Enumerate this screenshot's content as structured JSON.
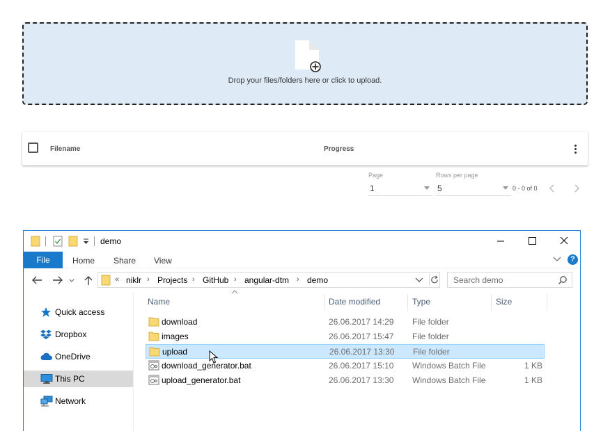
{
  "dropzone": {
    "text": "Drop your files/folders here or click to upload.",
    "icon": "file-add-icon"
  },
  "upload_table": {
    "columns": [
      "Filename",
      "Progress"
    ],
    "menu_icon": "more-vert-icon"
  },
  "paginator": {
    "page_label": "Page",
    "page_value": "1",
    "rows_label": "Rows per page",
    "rows_value": "5",
    "range": "0 - 0 of 0"
  },
  "explorer": {
    "title": "demo",
    "ribbon_tabs": [
      "File",
      "Home",
      "Share",
      "View"
    ],
    "address": {
      "prefix": "«",
      "crumbs": [
        "niklr",
        "Projects",
        "GitHub",
        "angular-dtm",
        "demo"
      ]
    },
    "search_placeholder": "Search demo",
    "nav_items": [
      {
        "label": "Quick access",
        "icon": "star-icon"
      },
      {
        "label": "Dropbox",
        "icon": "dropbox-icon"
      },
      {
        "label": "OneDrive",
        "icon": "cloud-icon"
      },
      {
        "label": "This PC",
        "icon": "computer-icon",
        "selected": true
      },
      {
        "label": "Network",
        "icon": "network-icon"
      }
    ],
    "columns": [
      "Name",
      "Date modified",
      "Type",
      "Size"
    ],
    "files": [
      {
        "name": "download",
        "date": "26.06.2017 14:29",
        "type": "File folder",
        "size": "",
        "icon": "folder-icon"
      },
      {
        "name": "images",
        "date": "26.06.2017 15:47",
        "type": "File folder",
        "size": "",
        "icon": "folder-icon"
      },
      {
        "name": "upload",
        "date": "26.06.2017 13:30",
        "type": "File folder",
        "size": "",
        "icon": "folder-icon",
        "selected": true
      },
      {
        "name": "download_generator.bat",
        "date": "26.06.2017 15:10",
        "type": "Windows Batch File",
        "size": "1 KB",
        "icon": "batch-file-icon"
      },
      {
        "name": "upload_generator.bat",
        "date": "26.06.2017 13:30",
        "type": "Windows Batch File",
        "size": "1 KB",
        "icon": "batch-file-icon"
      }
    ]
  },
  "colors": {
    "dropzone_bg": "#deeaf6",
    "accent": "#1979ca",
    "selection": "#cce8ff",
    "folder": "#f8d775"
  }
}
